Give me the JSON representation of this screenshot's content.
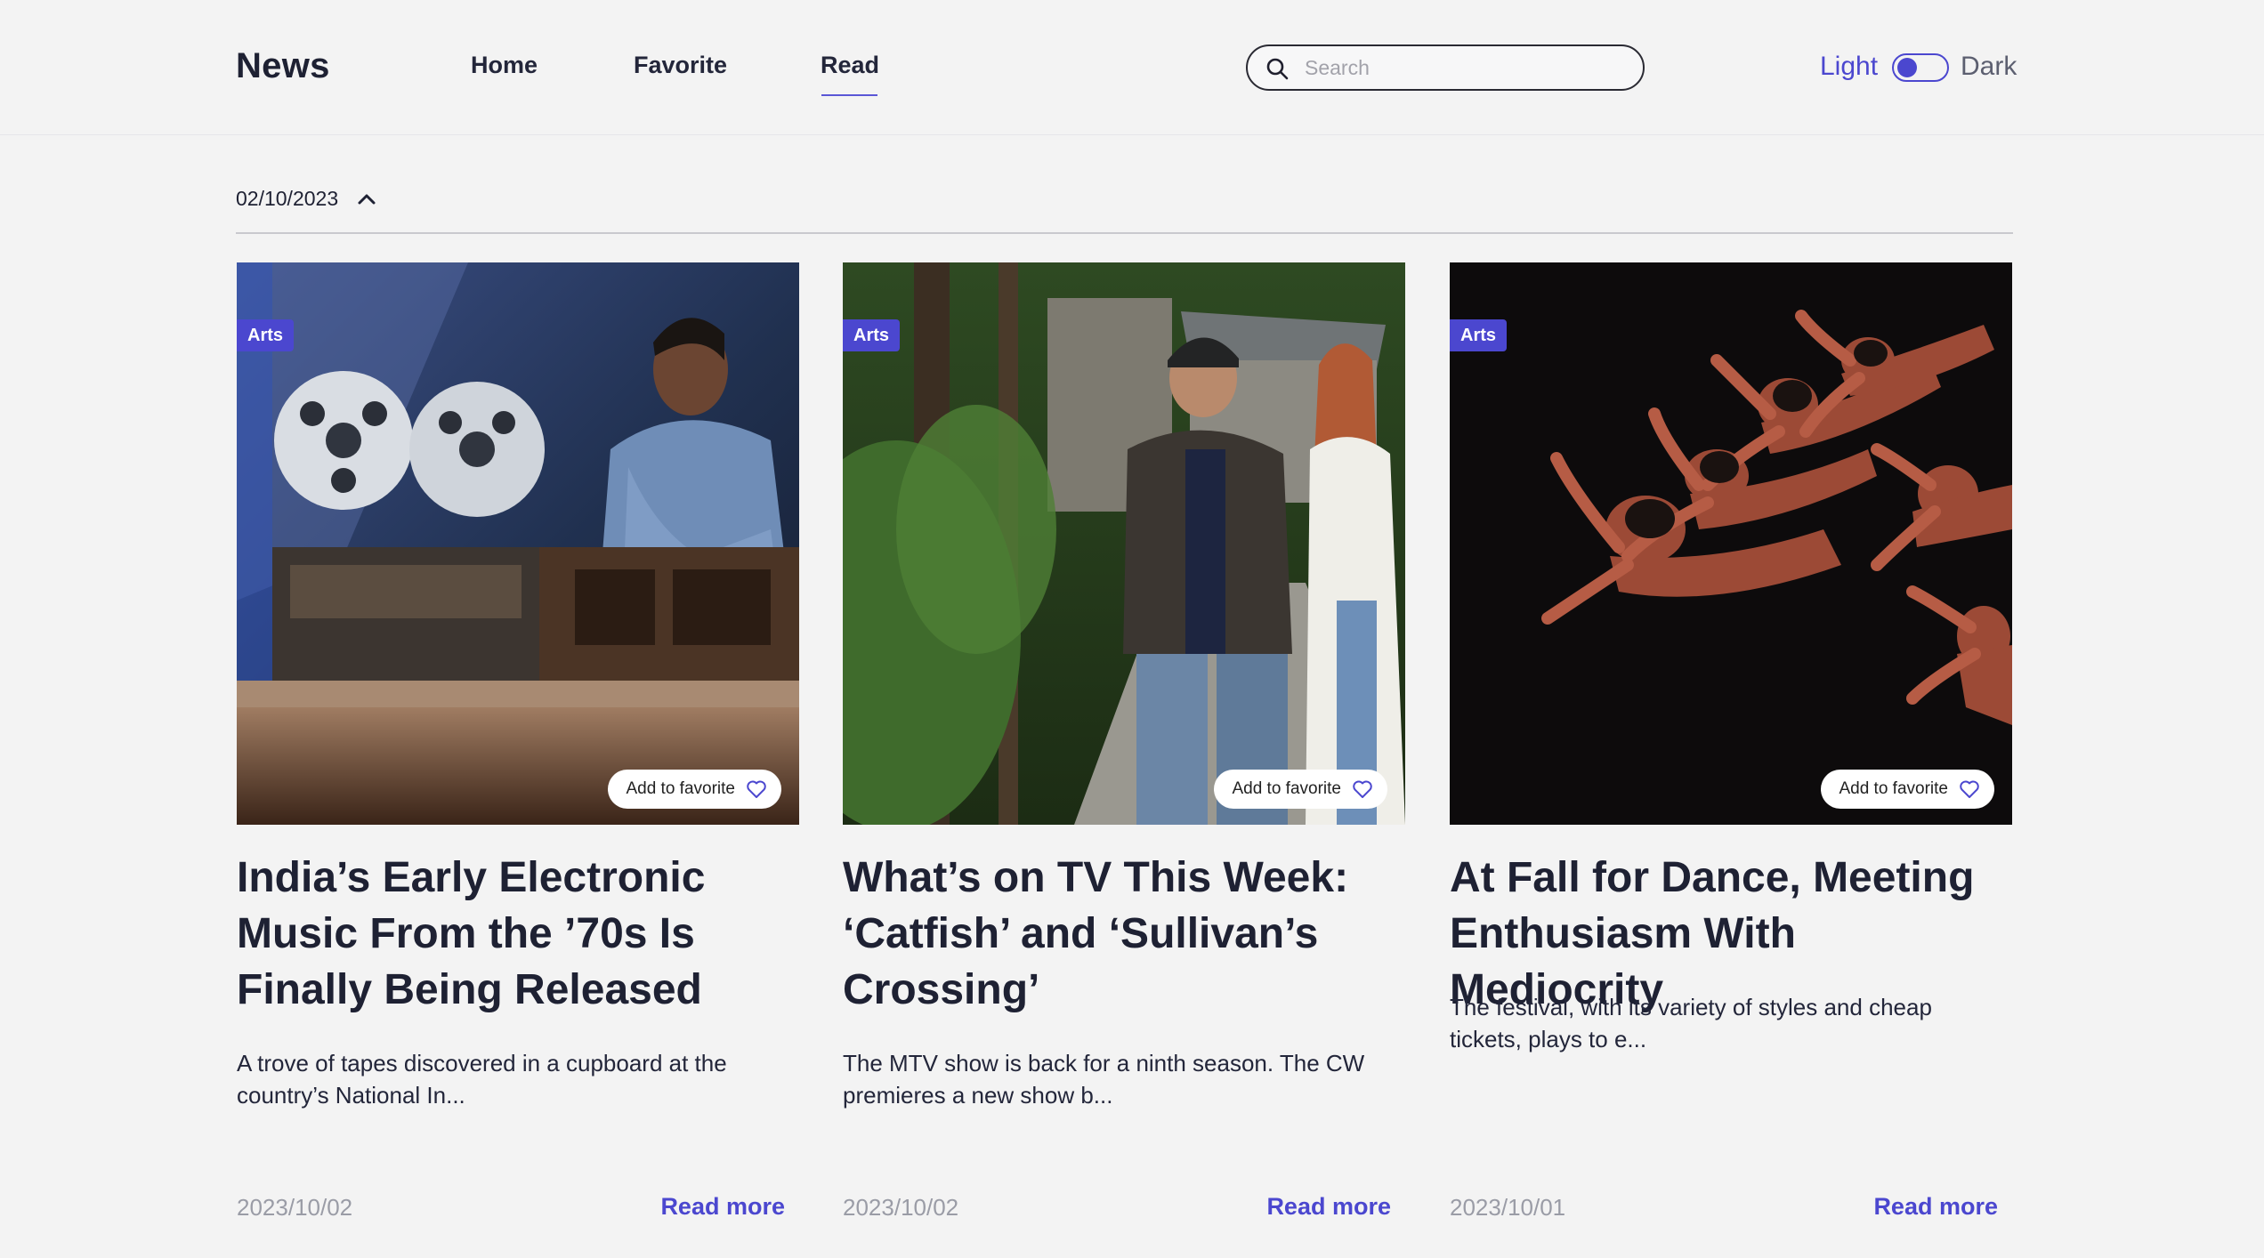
{
  "header": {
    "brand": "News",
    "nav": {
      "home": "Home",
      "favorite": "Favorite",
      "read": "Read",
      "active": "Read"
    },
    "search": {
      "placeholder": "Search",
      "value": "",
      "icon": "search-icon"
    },
    "theme": {
      "light_label": "Light",
      "dark_label": "Dark",
      "current": "Light"
    }
  },
  "date_group": {
    "date": "02/10/2023",
    "expanded": true,
    "icon": "chevron-up-icon"
  },
  "cards": [
    {
      "category": "Arts",
      "favorite_label": "Add to favorite",
      "title": "India’s Early Electronic Music From the ’70s Is Finally Being Released",
      "description": "A trove of tapes discovered in a cupboard at the country’s National In...",
      "date": "2023/10/02",
      "read_more": "Read more",
      "image": "man-with-reel-to-reel-tape-recorder"
    },
    {
      "category": "Arts",
      "favorite_label": "Add to favorite",
      "title": "What’s on TV This Week: ‘Catfish’ and ‘Sullivan’s Crossing’",
      "description": "The MTV show is back for a ninth season. The CW premieres a new show b...",
      "date": "2023/10/02",
      "read_more": "Read more",
      "image": "two-people-walking-in-forest"
    },
    {
      "category": "Arts",
      "favorite_label": "Add to favorite",
      "title": "At Fall for Dance, Meeting Enthusiasm With Mediocrity",
      "description": "The festival, with its variety of styles and cheap tickets, plays to e...",
      "date": "2023/10/01",
      "read_more": "Read more",
      "image": "dancers-reaching-on-dark-stage"
    }
  ],
  "colors": {
    "accent": "#4b47cf",
    "background": "#f3f3f3",
    "text": "#1e2133",
    "muted": "#9a9ca6"
  }
}
